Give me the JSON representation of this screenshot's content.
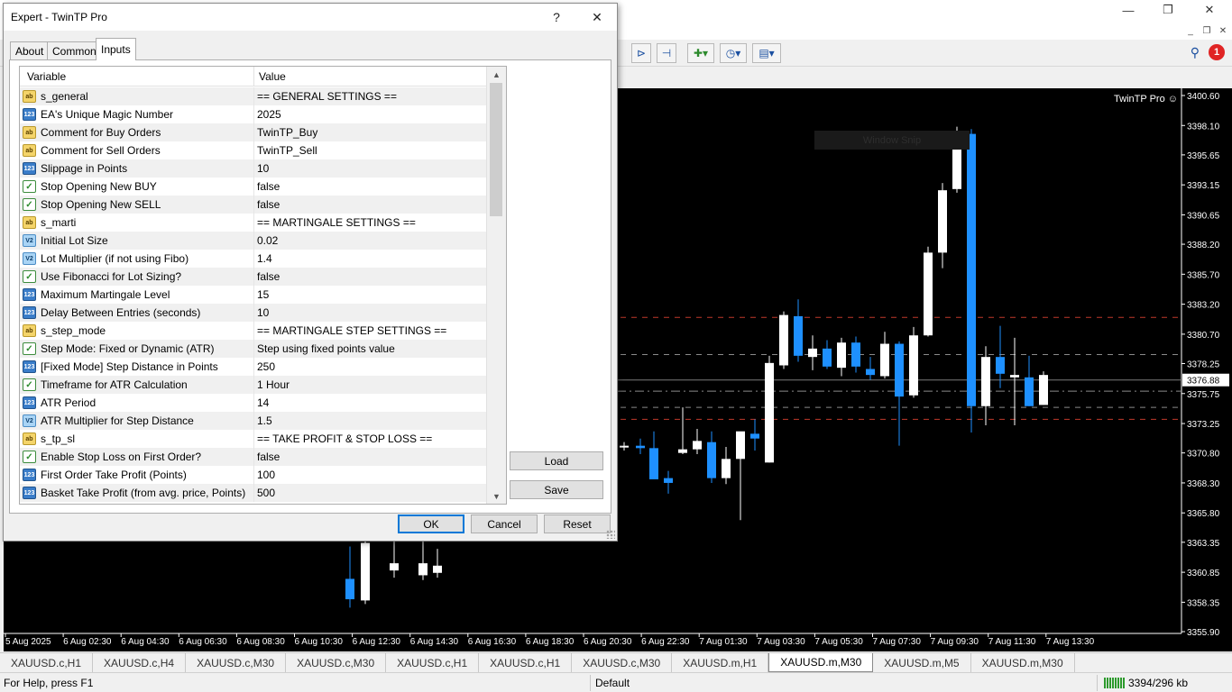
{
  "app": {
    "window_controls": {
      "minimize": "—",
      "maximize": "❐",
      "close": "✕"
    }
  },
  "toolbar": {
    "notification_count": "1"
  },
  "chart": {
    "ea_label": "TwinTP Pro",
    "overlay_text": "Window Snip",
    "price_labels": [
      "3400.60",
      "3398.10",
      "3395.65",
      "3393.15",
      "3390.65",
      "3388.20",
      "3385.70",
      "3383.20",
      "3380.70",
      "3378.25",
      "3375.75",
      "3373.25",
      "3370.80",
      "3368.30",
      "3365.80",
      "3363.35",
      "3360.85",
      "3358.35",
      "3355.90"
    ],
    "current_price": "3376.88",
    "time_labels": [
      "5 Aug 2025",
      "6 Aug 02:30",
      "6 Aug 04:30",
      "6 Aug 06:30",
      "6 Aug 08:30",
      "6 Aug 10:30",
      "6 Aug 12:30",
      "6 Aug 14:30",
      "6 Aug 16:30",
      "6 Aug 18:30",
      "6 Aug 20:30",
      "6 Aug 22:30",
      "7 Aug 01:30",
      "7 Aug 03:30",
      "7 Aug 05:30",
      "7 Aug 07:30",
      "7 Aug 09:30",
      "7 Aug 11:30",
      "7 Aug 13:30"
    ],
    "colors": {
      "bull": "#ffffff",
      "bear": "#1e90ff",
      "level_red": "#c0392b",
      "level_grey": "#8a8a8a",
      "background": "#000000"
    }
  },
  "symbol_tabs": [
    {
      "label": "XAUUSD.c,H1",
      "active": false
    },
    {
      "label": "XAUUSD.c,H4",
      "active": false
    },
    {
      "label": "XAUUSD.c,M30",
      "active": false
    },
    {
      "label": "XAUUSD.c,M30",
      "active": false
    },
    {
      "label": "XAUUSD.c,H1",
      "active": false
    },
    {
      "label": "XAUUSD.c,H1",
      "active": false
    },
    {
      "label": "XAUUSD.c,M30",
      "active": false
    },
    {
      "label": "XAUUSD.m,H1",
      "active": false
    },
    {
      "label": "XAUUSD.m,M30",
      "active": true
    },
    {
      "label": "XAUUSD.m,M5",
      "active": false
    },
    {
      "label": "XAUUSD.m,M30",
      "active": false
    }
  ],
  "statusbar": {
    "help": "For Help, press F1",
    "profile": "Default",
    "traffic": "3394/296 kb"
  },
  "dialog": {
    "title": "Expert - TwinTP Pro",
    "help_button": "?",
    "close_button": "✕",
    "tabs": [
      {
        "label": "About",
        "active": false
      },
      {
        "label": "Common",
        "active": false
      },
      {
        "label": "Inputs",
        "active": true
      }
    ],
    "columns": {
      "variable": "Variable",
      "value": "Value"
    },
    "rows": [
      {
        "type": "str",
        "variable": "s_general",
        "value": "== GENERAL SETTINGS =="
      },
      {
        "type": "int",
        "variable": "EA's Unique Magic Number",
        "value": "2025"
      },
      {
        "type": "str",
        "variable": "Comment for Buy Orders",
        "value": "TwinTP_Buy"
      },
      {
        "type": "str",
        "variable": "Comment for Sell Orders",
        "value": "TwinTP_Sell"
      },
      {
        "type": "int",
        "variable": "Slippage in Points",
        "value": "10"
      },
      {
        "type": "bool",
        "variable": "Stop Opening New BUY",
        "value": "false"
      },
      {
        "type": "bool",
        "variable": "Stop Opening New SELL",
        "value": "false"
      },
      {
        "type": "str",
        "variable": "s_marti",
        "value": "== MARTINGALE SETTINGS =="
      },
      {
        "type": "dbl",
        "variable": "Initial Lot Size",
        "value": "0.02"
      },
      {
        "type": "dbl",
        "variable": "Lot Multiplier (if not using Fibo)",
        "value": "1.4"
      },
      {
        "type": "bool",
        "variable": "Use Fibonacci for Lot Sizing?",
        "value": "false"
      },
      {
        "type": "int",
        "variable": "Maximum Martingale Level",
        "value": "15"
      },
      {
        "type": "int",
        "variable": "Delay Between Entries (seconds)",
        "value": "10"
      },
      {
        "type": "str",
        "variable": "s_step_mode",
        "value": "== MARTINGALE STEP SETTINGS =="
      },
      {
        "type": "bool",
        "variable": "Step Mode: Fixed or Dynamic (ATR)",
        "value": "Step using fixed points value"
      },
      {
        "type": "int",
        "variable": "[Fixed Mode] Step Distance in Points",
        "value": "250"
      },
      {
        "type": "bool",
        "variable": "Timeframe for ATR Calculation",
        "value": "1 Hour"
      },
      {
        "type": "int",
        "variable": "ATR Period",
        "value": "14"
      },
      {
        "type": "dbl",
        "variable": "ATR Multiplier for Step Distance",
        "value": "1.5"
      },
      {
        "type": "str",
        "variable": "s_tp_sl",
        "value": "== TAKE PROFIT & STOP LOSS =="
      },
      {
        "type": "bool",
        "variable": "Enable Stop Loss on First Order?",
        "value": "false"
      },
      {
        "type": "int",
        "variable": "First Order Take Profit (Points)",
        "value": "100"
      },
      {
        "type": "int",
        "variable": "Basket Take Profit (from avg. price, Points)",
        "value": "500"
      }
    ],
    "type_icons": {
      "str": "ab",
      "int": "123",
      "dbl": "V2",
      "bool": "✓"
    },
    "buttons": {
      "load": "Load",
      "save": "Save",
      "ok": "OK",
      "cancel": "Cancel",
      "reset": "Reset"
    }
  }
}
